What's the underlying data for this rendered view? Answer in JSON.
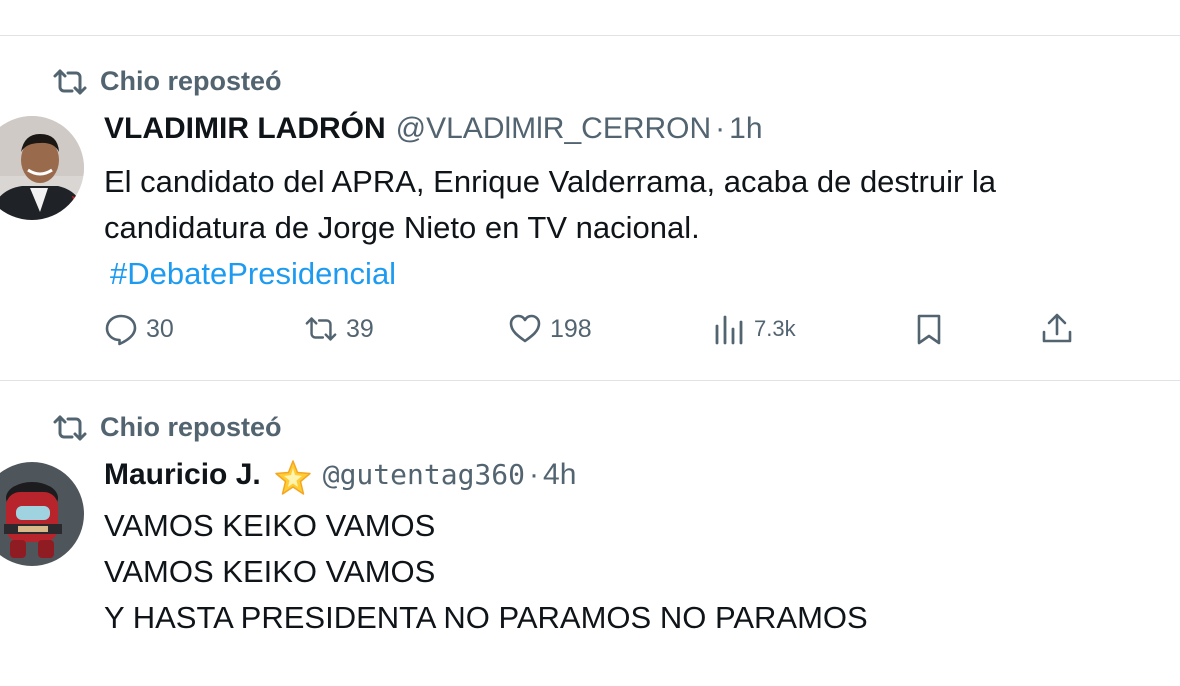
{
  "tweets": [
    {
      "repost_label": "Chio reposteó",
      "display_name": "VLADIMIR LADRÓN",
      "handle": "@VLADlMlR_CERRON",
      "separator": "·",
      "time": "1h",
      "text_lines": [
        "El candidato del APRA, Enrique Valderrama, acaba de destruir la",
        "candidatura de Jorge Nieto en TV nacional."
      ],
      "hashtag": "#DebatePresidencial",
      "actions": {
        "replies": "30",
        "reposts": "39",
        "likes": "198",
        "views": "7.3k"
      }
    },
    {
      "repost_label": "Chio reposteó",
      "display_name": "Mauricio J.",
      "badge_icon": "glowing-star-icon",
      "handle": "@gutentag360",
      "separator": "·",
      "time": "4h",
      "text_lines": [
        "VAMOS KEIKO VAMOS",
        "VAMOS KEIKO VAMOS",
        "Y HASTA PRESIDENTA NO PARAMOS NO PARAMOS"
      ]
    }
  ],
  "colors": {
    "text": "#0f1419",
    "secondary": "#536471",
    "link": "#1d9bf0",
    "divider": "#dfe3e6"
  }
}
